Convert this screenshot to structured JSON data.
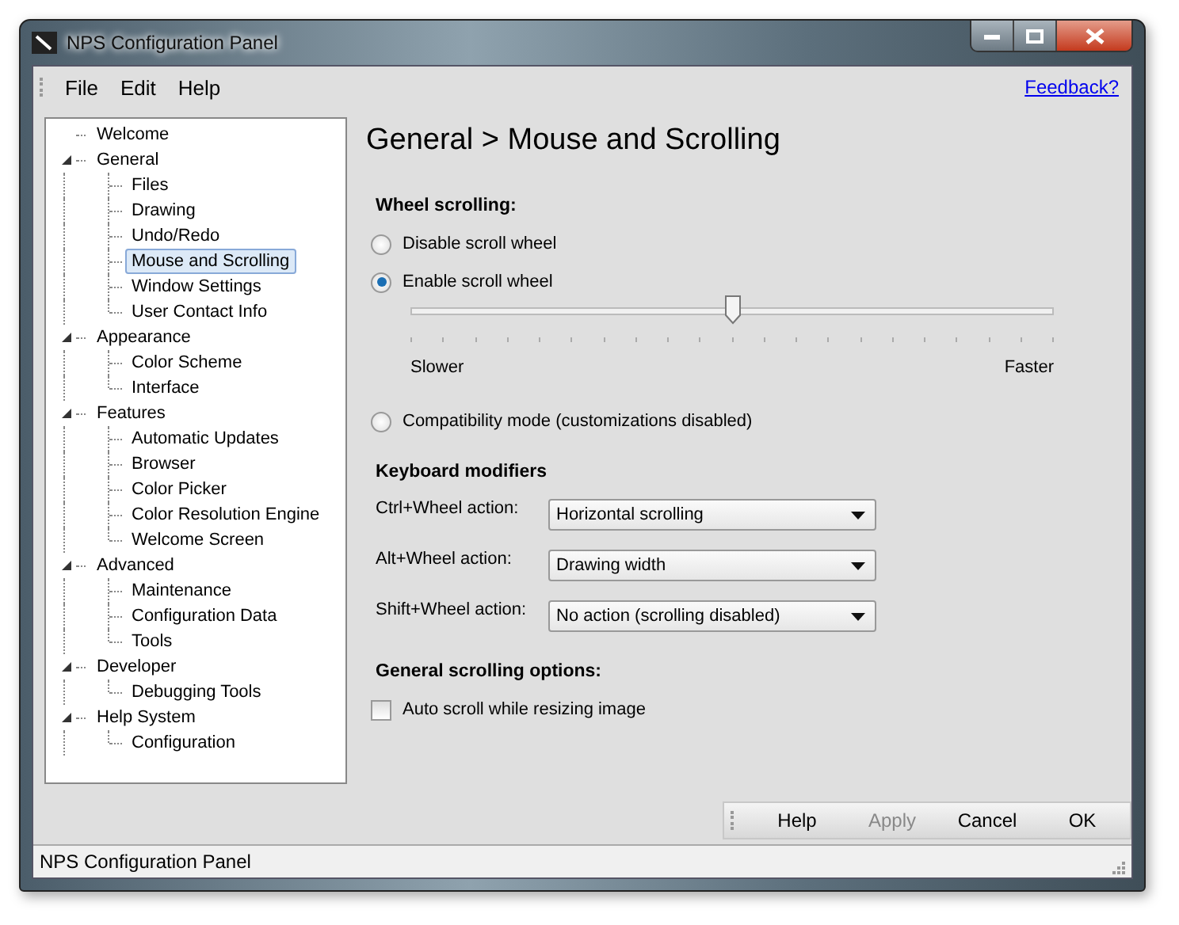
{
  "window": {
    "title": "NPS Configuration Panel"
  },
  "menu": [
    {
      "label": "File"
    },
    {
      "label": "Edit"
    },
    {
      "label": "Help"
    }
  ],
  "feedback_link": "Feedback?",
  "tree": [
    {
      "label": "Welcome",
      "selected": false
    },
    {
      "label": "General",
      "selected": false,
      "expanded": true,
      "children": [
        {
          "label": "Files",
          "selected": false
        },
        {
          "label": "Drawing",
          "selected": false
        },
        {
          "label": "Undo/Redo",
          "selected": false
        },
        {
          "label": "Mouse and Scrolling",
          "selected": true
        },
        {
          "label": "Window Settings",
          "selected": false
        },
        {
          "label": "User Contact Info",
          "selected": false
        }
      ]
    },
    {
      "label": "Appearance",
      "selected": false,
      "expanded": true,
      "children": [
        {
          "label": "Color Scheme",
          "selected": false
        },
        {
          "label": "Interface",
          "selected": false
        }
      ]
    },
    {
      "label": "Features",
      "selected": false,
      "expanded": true,
      "children": [
        {
          "label": "Automatic Updates",
          "selected": false
        },
        {
          "label": "Browser",
          "selected": false
        },
        {
          "label": "Color Picker",
          "selected": false
        },
        {
          "label": "Color Resolution Engine",
          "selected": false
        },
        {
          "label": "Welcome Screen",
          "selected": false
        }
      ]
    },
    {
      "label": "Advanced",
      "selected": false,
      "expanded": true,
      "children": [
        {
          "label": "Maintenance",
          "selected": false
        },
        {
          "label": "Configuration Data",
          "selected": false
        },
        {
          "label": "Tools",
          "selected": false
        }
      ]
    },
    {
      "label": "Developer",
      "selected": false,
      "expanded": true,
      "children": [
        {
          "label": "Debugging Tools",
          "selected": false
        }
      ]
    },
    {
      "label": "Help System",
      "selected": false,
      "expanded": true,
      "children": [
        {
          "label": "Configuration",
          "selected": false
        }
      ]
    }
  ],
  "page_title": "General > Mouse and Scrolling",
  "wheel_scrolling": {
    "heading": "Wheel scrolling:",
    "items": [
      {
        "kind": "radio",
        "label": "Disable scroll wheel",
        "selected": false
      },
      {
        "kind": "radio",
        "label": "Enable scroll wheel",
        "selected": true
      },
      {
        "kind": "slider",
        "level": 0.5,
        "min_label": "Slower",
        "max_label": "Faster"
      },
      {
        "kind": "radio",
        "label": "Compatibility mode (customizations disabled)",
        "selected": false
      }
    ]
  },
  "keyboard_modifiers": {
    "heading": "Keyboard modifiers",
    "rows": [
      {
        "label": "Ctrl+Wheel action:",
        "value": "Horizontal scrolling"
      },
      {
        "label": "Alt+Wheel action:",
        "value": "Drawing width"
      },
      {
        "label": "Shift+Wheel action:",
        "value": "No action (scrolling disabled)"
      }
    ]
  },
  "general_scrolling": {
    "heading": "General scrolling options:",
    "options": [
      {
        "label": "Auto scroll while resizing image",
        "checked": false
      }
    ]
  },
  "buttons": [
    {
      "label": "Help",
      "disabled": false
    },
    {
      "label": "Apply",
      "disabled": true
    },
    {
      "label": "Cancel",
      "disabled": false
    },
    {
      "label": "OK",
      "disabled": false
    }
  ],
  "status_bar": "NPS Configuration Panel"
}
